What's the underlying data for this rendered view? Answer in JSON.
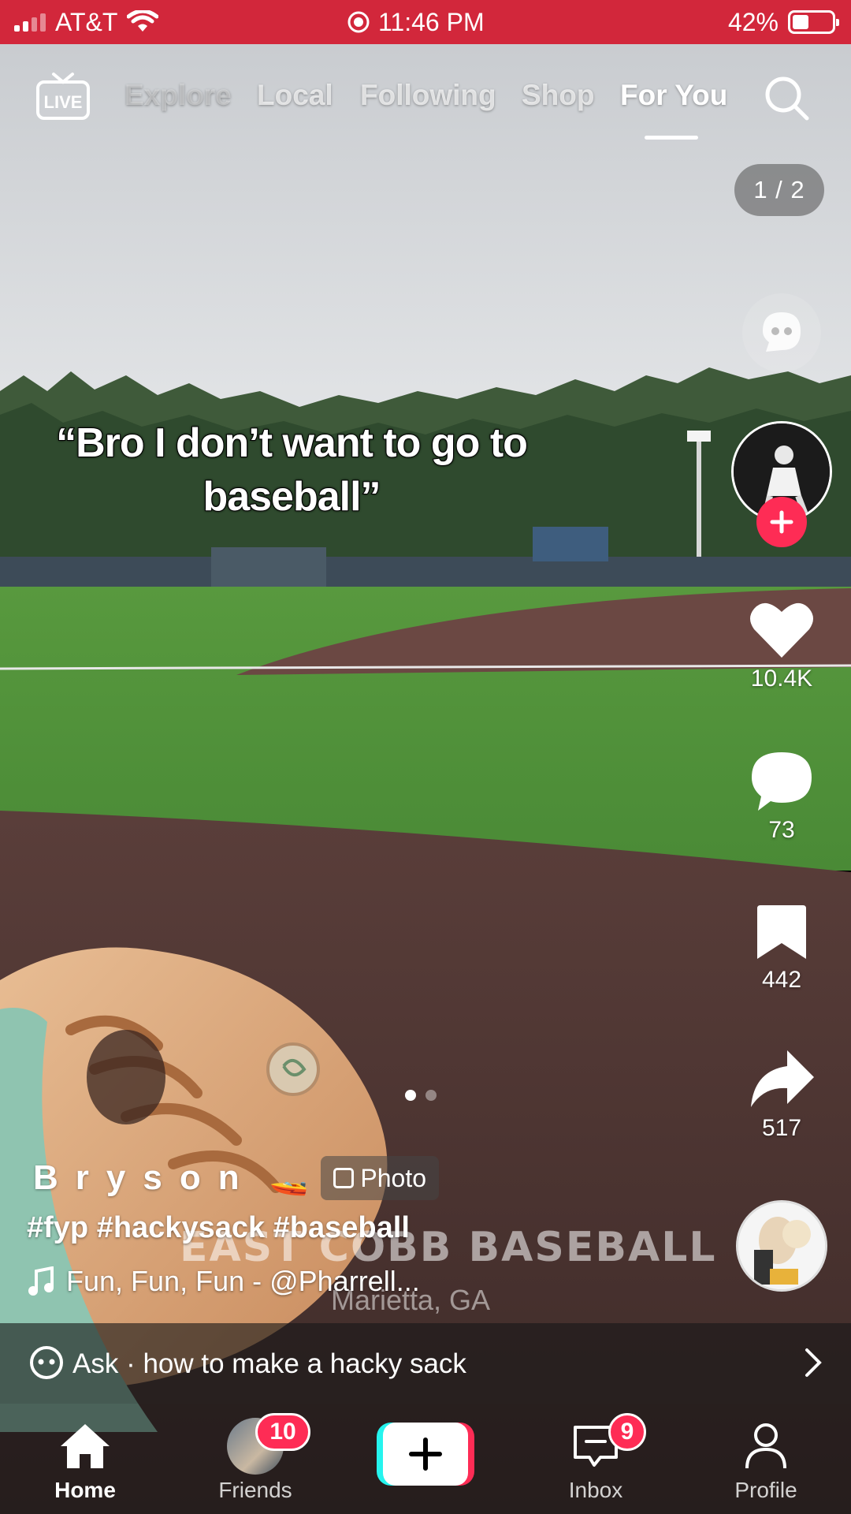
{
  "status_bar": {
    "carrier": "AT&T",
    "time": "11:46 PM",
    "battery_percent": "42%",
    "battery_level": 0.42,
    "background_color": "#d2273b"
  },
  "top_nav": {
    "live_label": "LIVE",
    "tabs": [
      {
        "label": "Explore"
      },
      {
        "label": "Local"
      },
      {
        "label": "Following"
      },
      {
        "label": "Shop"
      },
      {
        "label": "For You"
      }
    ],
    "active_tab": "For You"
  },
  "post": {
    "photo_counter": "1 / 2",
    "overlay_caption_line1": "“Bro I don’t want to go to",
    "overlay_caption_line2": "baseball”",
    "photo_watermark": "EAST COBB BASEBALL",
    "photo_watermark_sub": "Marietta, GA",
    "username": "Bryson",
    "username_emoji": "🚤",
    "photo_badge": "Photo",
    "hashtags": "#fyp #hackysack #baseball",
    "sound": "Fun, Fun, Fun - @Pharrell...",
    "current_slide": 1,
    "total_slides": 2
  },
  "actions": {
    "likes": "10.4K",
    "comments": "73",
    "saves": "442",
    "shares": "517"
  },
  "ask_bar": {
    "text": "Ask · how to make a hacky sack"
  },
  "tab_bar": {
    "home": "Home",
    "friends": "Friends",
    "friends_badge": "10",
    "inbox": "Inbox",
    "inbox_badge": "9",
    "profile": "Profile"
  },
  "colors": {
    "accent": "#fe2c55",
    "accent_cyan": "#25f4ee",
    "turf": "#4f8f3a",
    "infield_dirt": "#5a3d38"
  }
}
